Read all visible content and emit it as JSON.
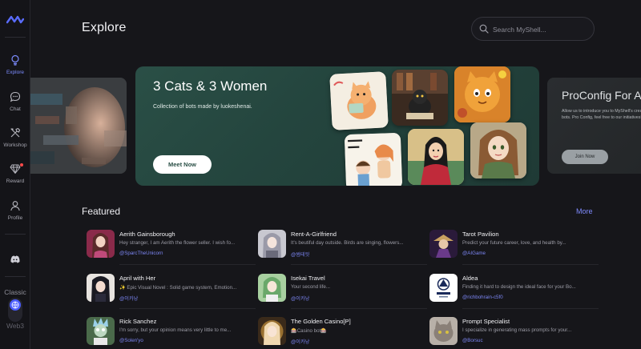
{
  "header": {
    "title": "Explore"
  },
  "search": {
    "placeholder": "Search MyShell..."
  },
  "sidebar": {
    "items": [
      {
        "label": "Explore",
        "icon": "explore-icon",
        "active": true
      },
      {
        "label": "Chat",
        "icon": "chat-icon"
      },
      {
        "label": "Workshop",
        "icon": "workshop-icon"
      },
      {
        "label": "Reward",
        "icon": "reward-icon",
        "badge": true
      },
      {
        "label": "Profile",
        "icon": "profile-icon"
      }
    ],
    "discord_icon": "discord-icon",
    "mode_classic": "Classic",
    "mode_web3": "Web3"
  },
  "banner": {
    "title": "3 Cats & 3 Women",
    "subtitle": "Collection of bots made by luokeshenai.",
    "button": "Meet Now"
  },
  "banner_right": {
    "title": "ProConfig For A",
    "description": "Allow us to introduce you to MyShell's creating bots. Pro Config, feel free to our initiatives!...",
    "button": "Join Now"
  },
  "featured": {
    "title": "Featured",
    "more": "More",
    "items": [
      {
        "name": "Aerith Gainsborough",
        "desc": "Hey stranger, I am Aerith the flower seller. I wish fo...",
        "author": "@SparcTheUnicorn"
      },
      {
        "name": "Rent-A-Girlfriend",
        "desc": "It's beutiful day outside. Birds are singing, flowers...",
        "author": "@썸테읫"
      },
      {
        "name": "Tarot Pavilion",
        "desc": "Predict your future career, love, and health by...",
        "author": "@AIGame"
      },
      {
        "name": "April with Her",
        "desc": "✨ Epic Visual Novel : Solid game system, Emotion...",
        "author": "@이카낭"
      },
      {
        "name": "Isekai Travel",
        "desc": "Your second life...",
        "author": "@이카낭"
      },
      {
        "name": "Aldea",
        "desc": "Finding it hard to design the ideal face for your Bo...",
        "author": "@richbohrain-c5f0"
      },
      {
        "name": "Rick Sanchez",
        "desc": "I'm sorry, but your opinion means very little to me...",
        "author": "@Solen'yo"
      },
      {
        "name": "The Golden Casino[P]",
        "desc": "🎰Casino bot🎰",
        "author": "@이카낭"
      },
      {
        "name": "Prompt Specialist",
        "desc": "I specialize in generating mass prompts for your...",
        "author": "@Borsuc"
      }
    ]
  },
  "colors": {
    "accent": "#7d8cff",
    "banner_bg": "#2a4f46",
    "page_bg": "#16161a"
  }
}
